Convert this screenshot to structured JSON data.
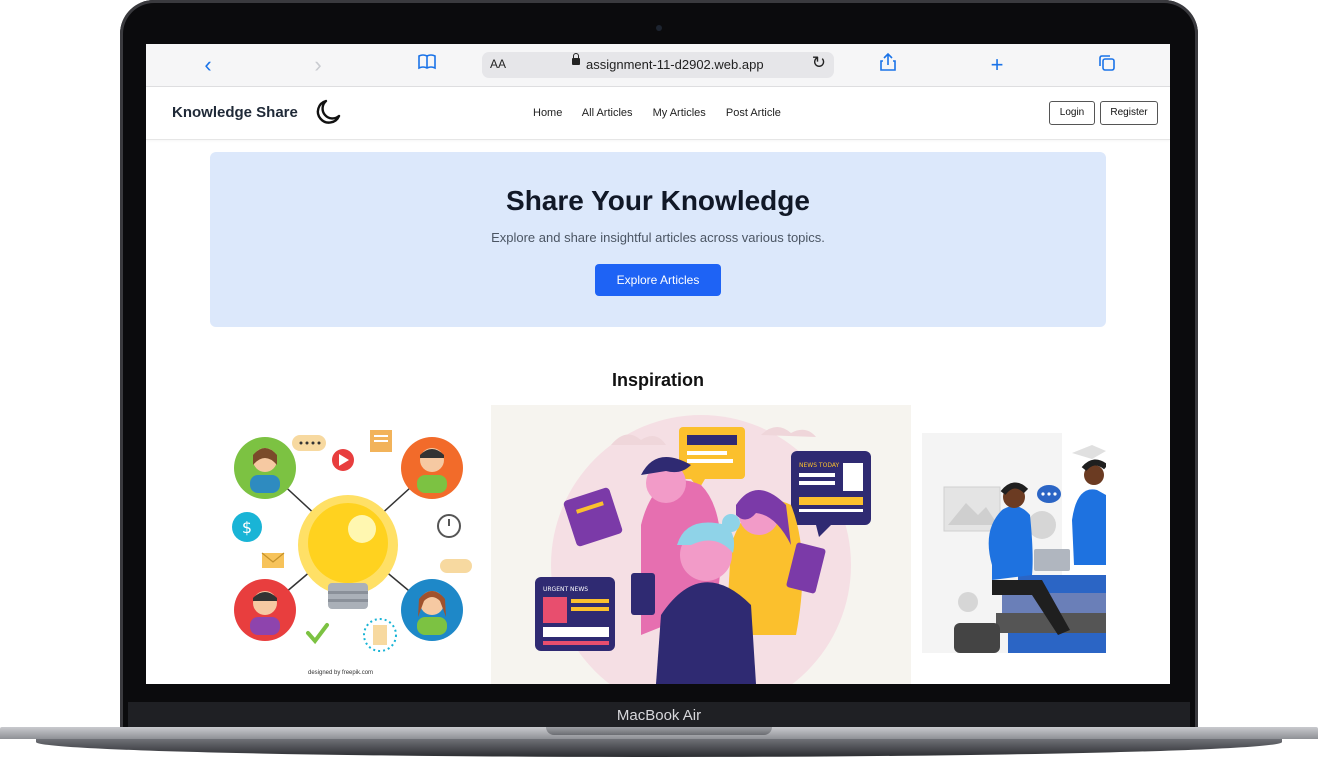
{
  "device": {
    "label": "MacBook Air"
  },
  "browser": {
    "text_size_label": "AA",
    "url": "assignment-11-d2902.web.app",
    "icons": [
      "back-icon",
      "forward-icon",
      "bookmarks-icon",
      "share-icon",
      "new-tab-icon",
      "tabs-icon",
      "reload-icon",
      "lock-icon"
    ]
  },
  "site": {
    "brand": "Knowledge Share",
    "theme_icon": "moon-icon",
    "nav": [
      "Home",
      "All Articles",
      "My Articles",
      "Post Article"
    ],
    "auth": {
      "login": "Login",
      "register": "Register"
    }
  },
  "hero": {
    "title": "Share Your Knowledge",
    "subtitle": "Explore and share insightful articles across various topics.",
    "cta": "Explore Articles"
  },
  "inspiration": {
    "title": "Inspiration",
    "credit": "designed by freepik.com"
  },
  "colors": {
    "accent": "#1e63f5",
    "hero_bg": "#dce8fb"
  }
}
